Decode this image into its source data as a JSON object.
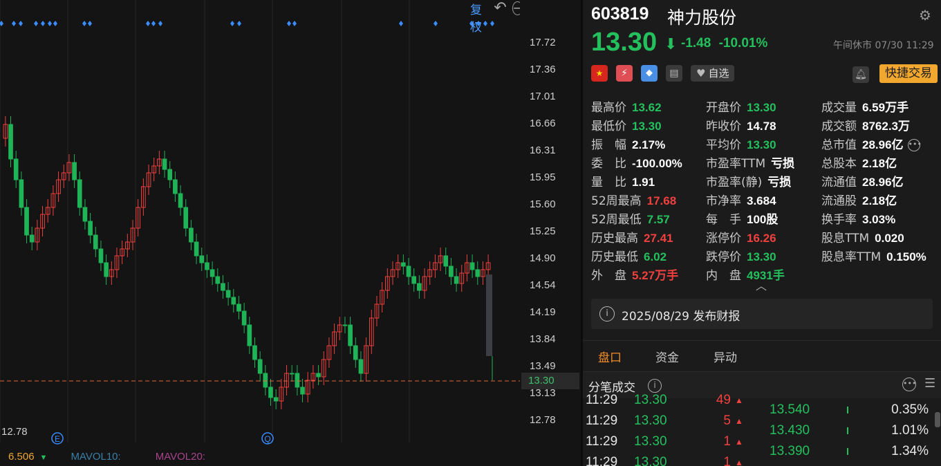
{
  "toolbar": {
    "adjust_label": "前复权",
    "undo_glyph": "↶",
    "zoom_out_glyph": "−",
    "zoom_in_glyph": "+"
  },
  "chart_data": {
    "type": "candlestick",
    "y_ticks": [
      "17.72",
      "17.36",
      "17.01",
      "16.66",
      "16.31",
      "15.95",
      "15.60",
      "15.25",
      "14.90",
      "14.54",
      "14.19",
      "13.84",
      "13.49",
      "13.13",
      "12.78"
    ],
    "current_price_label": "13.30",
    "low_marker_label": "12.78",
    "markers": [
      "E",
      "Q"
    ],
    "volume": {
      "value": "6.506",
      "ma10_label": "MAVOL10:",
      "ma20_label": "MAVOL20:"
    },
    "colors": {
      "up": "#f0413f",
      "down": "#1fb457",
      "price_line": "#e0673a",
      "marker": "#3b8cff"
    }
  },
  "stock": {
    "code": "603819",
    "name": "神力股份",
    "price": "13.30",
    "arrow": "⬇",
    "change": "-1.48",
    "change_pct": "-10.01%",
    "status": "午间休市 07/30 11:29"
  },
  "actions": {
    "watch_label": "自选",
    "trade_label": "快捷交易"
  },
  "stats": {
    "col1": [
      {
        "label": "最高价",
        "value": "13.62",
        "color": "g"
      },
      {
        "label": "最低价",
        "value": "13.30",
        "color": "g"
      },
      {
        "label": "振　幅",
        "value": "2.17%",
        "color": "w"
      },
      {
        "label": "委　比",
        "value": "-100.00%",
        "color": "w"
      },
      {
        "label": "量　比",
        "value": "1.91",
        "color": "w"
      },
      {
        "label": "52周最高",
        "value": "17.68",
        "color": "r"
      },
      {
        "label": "52周最低",
        "value": "7.57",
        "color": "g"
      },
      {
        "label": "历史最高",
        "value": "27.41",
        "color": "r"
      },
      {
        "label": "历史最低",
        "value": "6.02",
        "color": "g"
      },
      {
        "label": "外　盘",
        "value": "5.27万手",
        "color": "r"
      }
    ],
    "col2": [
      {
        "label": "开盘价",
        "value": "13.30",
        "color": "g"
      },
      {
        "label": "昨收价",
        "value": "14.78",
        "color": "w"
      },
      {
        "label": "平均价",
        "value": "13.30",
        "color": "g"
      },
      {
        "label": "市盈率TTM",
        "value": "亏损",
        "color": "w"
      },
      {
        "label": "市盈率(静)",
        "value": "亏损",
        "color": "w"
      },
      {
        "label": "市净率",
        "value": "3.684",
        "color": "w"
      },
      {
        "label": "每　手",
        "value": "100股",
        "color": "w"
      },
      {
        "label": "涨停价",
        "value": "16.26",
        "color": "r"
      },
      {
        "label": "跌停价",
        "value": "13.30",
        "color": "g"
      },
      {
        "label": "内　盘",
        "value": "4931手",
        "color": "g"
      }
    ],
    "col3": [
      {
        "label": "成交量",
        "value": "6.59万手",
        "color": "w"
      },
      {
        "label": "成交额",
        "value": "8762.3万",
        "color": "w"
      },
      {
        "label": "总市值",
        "value": "28.96亿",
        "color": "w"
      },
      {
        "label": "总股本",
        "value": "2.18亿",
        "color": "w"
      },
      {
        "label": "流通值",
        "value": "28.96亿",
        "color": "w"
      },
      {
        "label": "流通股",
        "value": "2.18亿",
        "color": "w"
      },
      {
        "label": "换手率",
        "value": "3.03%",
        "color": "w"
      },
      {
        "label": "股息TTM",
        "value": "0.020",
        "color": "w"
      },
      {
        "label": "股息率TTM",
        "value": "0.150%",
        "color": "w"
      }
    ]
  },
  "notice": {
    "text": "2025/08/29  发布财报"
  },
  "tabs": [
    {
      "label": "盘口"
    },
    {
      "label": "资金"
    },
    {
      "label": "异动"
    }
  ],
  "section": {
    "title": "分笔成交"
  },
  "ticks": [
    {
      "time": "11:29",
      "price": "13.30",
      "vol": "49"
    },
    {
      "time": "11:29",
      "price": "13.30",
      "vol": "5"
    },
    {
      "time": "11:29",
      "price": "13.30",
      "vol": "1"
    },
    {
      "time": "11:29",
      "price": "13.30",
      "vol": "1"
    }
  ],
  "distribution": [
    {
      "price": "13.540",
      "pct": "0.35%"
    },
    {
      "price": "13.430",
      "pct": "1.01%"
    },
    {
      "price": "13.390",
      "pct": "1.34%"
    }
  ]
}
